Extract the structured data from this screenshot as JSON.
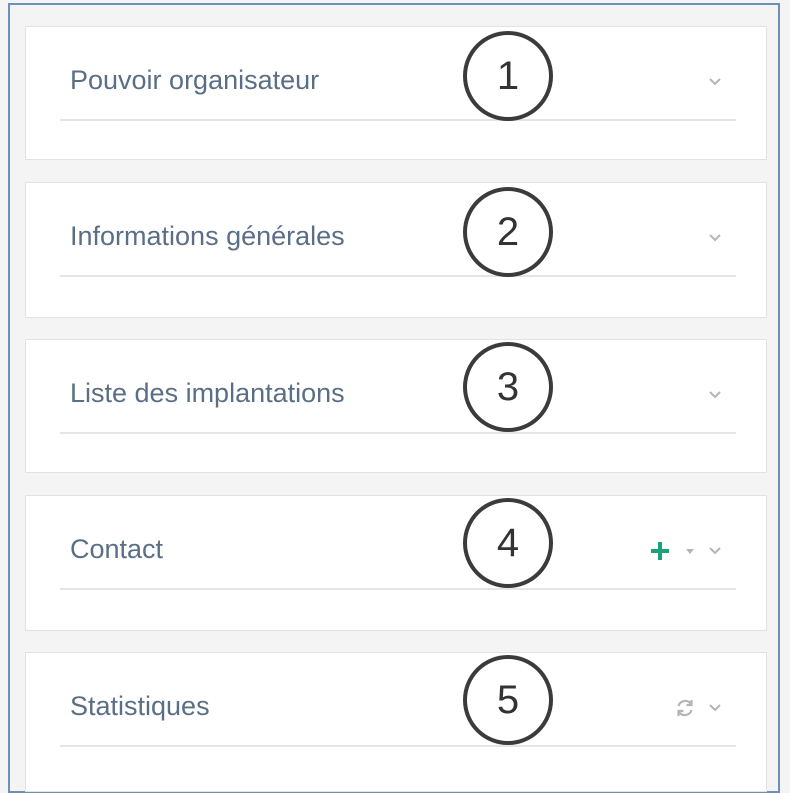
{
  "panels": [
    {
      "title": "Pouvoir organisateur",
      "number": "1",
      "tools": [
        "chevron-down"
      ]
    },
    {
      "title": "Informations générales",
      "number": "2",
      "tools": [
        "chevron-down"
      ]
    },
    {
      "title": "Liste des implantations",
      "number": "3",
      "tools": [
        "chevron-down"
      ]
    },
    {
      "title": "Contact",
      "number": "4",
      "tools": [
        "plus",
        "caret-down",
        "chevron-down"
      ]
    },
    {
      "title": "Statistiques",
      "number": "5",
      "tools": [
        "refresh",
        "chevron-down"
      ]
    }
  ],
  "colors": {
    "frame_border": "#6d8fb8",
    "title_text": "#5a6f86",
    "plus_accent": "#1aa37a",
    "muted_icon": "#b5b5b5"
  }
}
